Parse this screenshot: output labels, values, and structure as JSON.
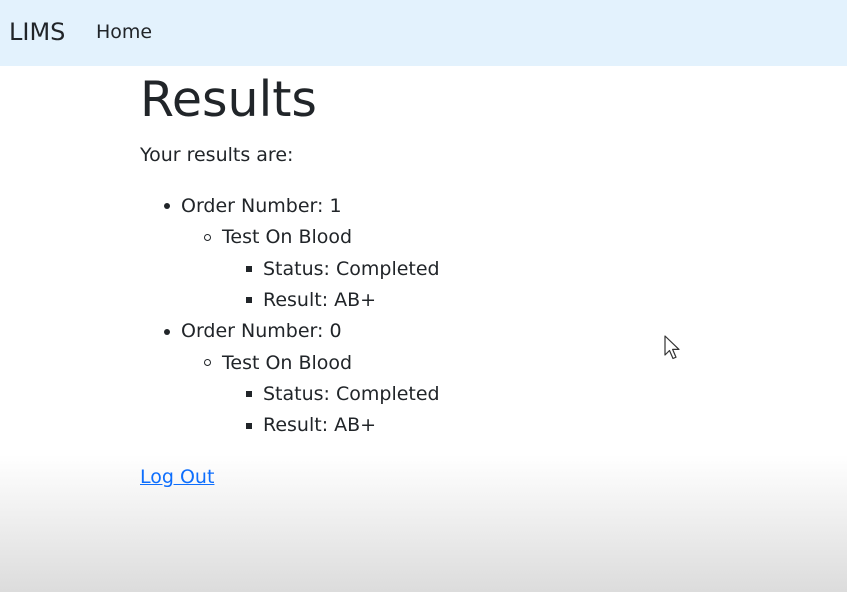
{
  "navbar": {
    "brand": "LIMS",
    "home_link": "Home"
  },
  "page": {
    "title": "Results",
    "intro": "Your results are:",
    "logout_link": "Log Out"
  },
  "orders": [
    {
      "label": "Order Number: 1",
      "tests": [
        {
          "label": "Test On Blood",
          "details": [
            "Status: Completed",
            "Result: AB+"
          ]
        }
      ]
    },
    {
      "label": "Order Number: 0",
      "tests": [
        {
          "label": "Test On Blood",
          "details": [
            "Status: Completed",
            "Result: AB+"
          ]
        }
      ]
    }
  ],
  "icons": {
    "cursor": "mouse-pointer-icon"
  }
}
